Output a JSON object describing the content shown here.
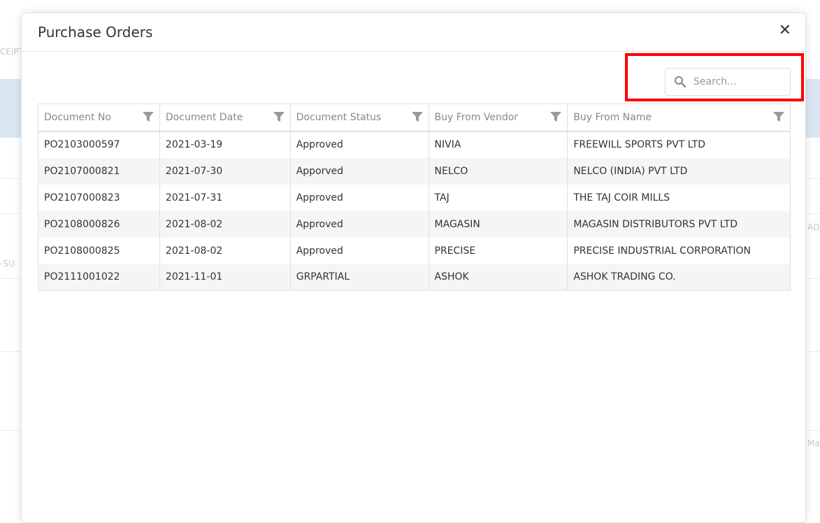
{
  "background": {
    "fragments": [
      "CEIPT",
      "-SU-",
      "ADV",
      "Ma"
    ]
  },
  "modal": {
    "title": "Purchase Orders",
    "close_label": "✕"
  },
  "search": {
    "placeholder": "Search...",
    "value": ""
  },
  "table": {
    "columns": [
      "Document No",
      "Document Date",
      "Document Status",
      "Buy From Vendor",
      "Buy From Name"
    ],
    "rows": [
      [
        "PO2103000597",
        "2021-03-19",
        "Approved",
        "NIVIA",
        "FREEWILL SPORTS PVT LTD"
      ],
      [
        "PO2107000821",
        "2021-07-30",
        "Apporved",
        "NELCO",
        "NELCO (INDIA) PVT LTD"
      ],
      [
        "PO2107000823",
        "2021-07-31",
        "Approved",
        "TAJ",
        "THE TAJ COIR MILLS"
      ],
      [
        "PO2108000826",
        "2021-08-02",
        "Approved",
        "MAGASIN",
        "MAGASIN DISTRIBUTORS PVT LTD"
      ],
      [
        "PO2108000825",
        "2021-08-02",
        "Approved",
        "PRECISE",
        "PRECISE INDUSTRIAL CORPORATION"
      ],
      [
        "PO2111001022",
        "2021-11-01",
        "GRPARTIAL",
        "ASHOK",
        "ASHOK TRADING CO."
      ]
    ]
  },
  "colors": {
    "highlight": "#ff0000",
    "row_alt": "#f5f5f5"
  }
}
